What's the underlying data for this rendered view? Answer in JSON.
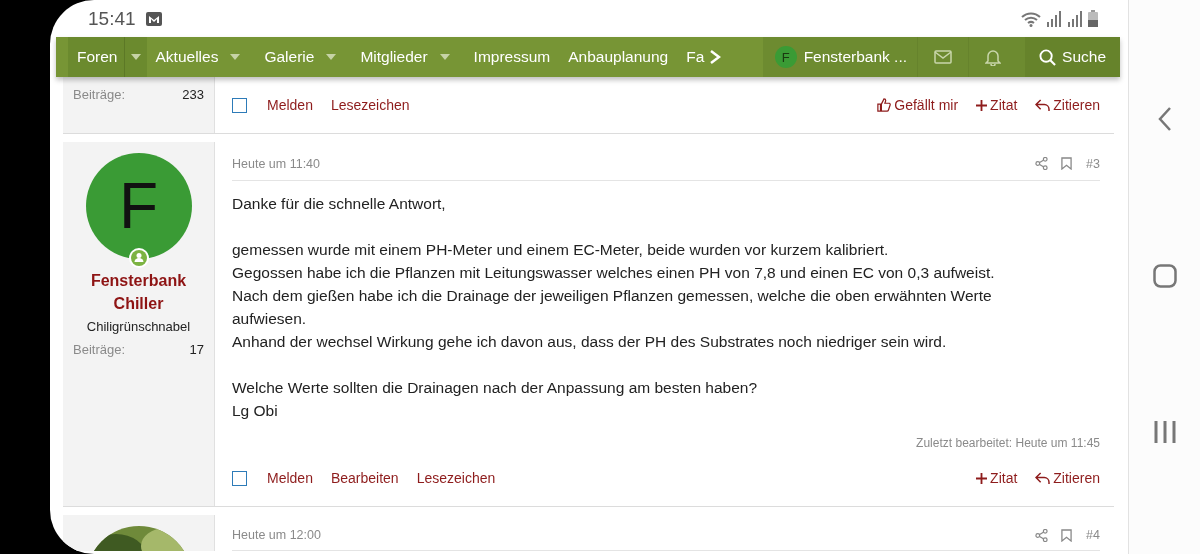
{
  "status_bar": {
    "time": "15:41"
  },
  "nav": {
    "items": [
      {
        "label": "Foren",
        "dropdown": true,
        "selected": true
      },
      {
        "label": "Aktuelles",
        "dropdown": true,
        "selected": false
      },
      {
        "label": "Galerie",
        "dropdown": true,
        "selected": false
      },
      {
        "label": "Mitglieder",
        "dropdown": true,
        "selected": false
      },
      {
        "label": "Impressum",
        "dropdown": false,
        "selected": false
      },
      {
        "label": "Anbauplanung",
        "dropdown": false,
        "selected": false
      },
      {
        "label": "Fa",
        "dropdown": false,
        "selected": false
      }
    ],
    "user": {
      "initial": "F",
      "name": "Fensterbank ..."
    },
    "search": "Suche"
  },
  "posts": [
    {
      "user": {
        "posts_label": "Beiträge:",
        "posts": "233"
      },
      "actions_left": [
        {
          "kind": "checkbox",
          "checked": false
        },
        {
          "kind": "link",
          "label": "Melden"
        },
        {
          "kind": "link",
          "label": "Lesezeichen"
        }
      ],
      "actions_right": [
        {
          "kind": "like",
          "label": "Gefällt mir"
        },
        {
          "kind": "quote",
          "label": "Zitat"
        },
        {
          "kind": "reply",
          "label": "Zitieren"
        }
      ]
    },
    {
      "date": "Heute um 11:40",
      "number": "#3",
      "user": {
        "avatar": {
          "kind": "letter",
          "initial": "F",
          "color": "#3a9b35"
        },
        "online": true,
        "name": "Fensterbank Chiller",
        "title": "Chiligrünschnabel",
        "posts_label": "Beiträge:",
        "posts": "17"
      },
      "body": [
        [
          "Danke für die schnelle Antwort,"
        ],
        [
          "gemessen wurde mit einem PH-Meter und einem EC-Meter, beide wurden vor kurzem kalibriert.",
          "Gegossen habe ich die Pflanzen mit Leitungswasser welches einen PH von 7,8 und einen EC von 0,3 aufweist.",
          "Nach dem gießen habe ich die Drainage der jeweiligen Pflanzen gemessen, welche die oben erwähnten Werte aufwiesen.",
          "Anhand der wechsel Wirkung gehe ich davon aus, dass der PH des Substrates noch niedriger sein wird."
        ],
        [
          "Welche Werte sollten die Drainagen nach der Anpassung am besten haben?",
          "Lg Obi"
        ]
      ],
      "edited": "Zuletzt bearbeitet: Heute um 11:45",
      "actions_left": [
        {
          "kind": "checkbox",
          "checked": false
        },
        {
          "kind": "link",
          "label": "Melden"
        },
        {
          "kind": "link",
          "label": "Bearbeiten"
        },
        {
          "kind": "link",
          "label": "Lesezeichen"
        }
      ],
      "actions_right": [
        {
          "kind": "quote",
          "label": "Zitat"
        },
        {
          "kind": "reply",
          "label": "Zitieren"
        }
      ]
    },
    {
      "date": "Heute um 12:00",
      "number": "#4"
    }
  ]
}
